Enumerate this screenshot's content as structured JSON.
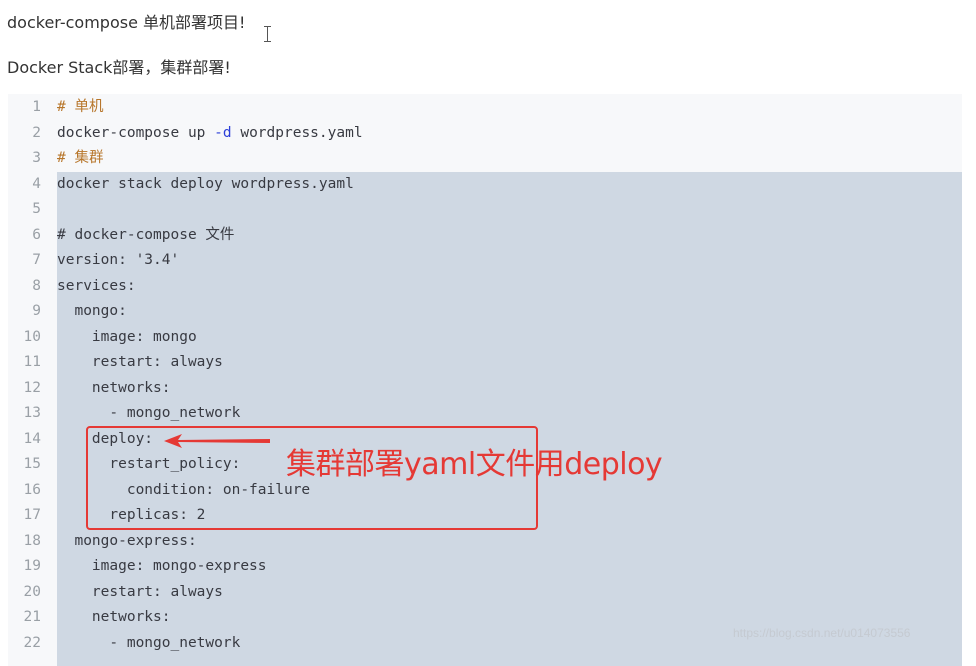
{
  "paragraphs": {
    "p1": "docker-compose  单机部署项目!",
    "p2": "Docker Stack部署，集群部署!"
  },
  "code": {
    "lines": [
      {
        "num": "1",
        "text": "# 单机",
        "type": "comment"
      },
      {
        "num": "2",
        "pre": "docker-compose up ",
        "flag": "-d",
        "post": " wordpress.yaml",
        "type": "flag"
      },
      {
        "num": "3",
        "text": "# 集群",
        "type": "comment"
      },
      {
        "num": "4",
        "text": "docker stack deploy wordpress.yaml",
        "type": "plain"
      },
      {
        "num": "5",
        "text": "",
        "type": "plain"
      },
      {
        "num": "6",
        "text": "# docker-compose 文件",
        "type": "plain"
      },
      {
        "num": "7",
        "text": "version: '3.4'",
        "type": "plain"
      },
      {
        "num": "8",
        "text": "services:",
        "type": "plain"
      },
      {
        "num": "9",
        "text": "  mongo:",
        "type": "plain"
      },
      {
        "num": "10",
        "text": "    image: mongo",
        "type": "plain"
      },
      {
        "num": "11",
        "text": "    restart: always",
        "type": "plain"
      },
      {
        "num": "12",
        "text": "    networks:",
        "type": "plain"
      },
      {
        "num": "13",
        "text": "      - mongo_network",
        "type": "plain"
      },
      {
        "num": "14",
        "text": "    deploy:",
        "type": "plain"
      },
      {
        "num": "15",
        "text": "      restart_policy:",
        "type": "plain"
      },
      {
        "num": "16",
        "text": "        condition: on-failure",
        "type": "plain"
      },
      {
        "num": "17",
        "text": "      replicas: 2",
        "type": "plain"
      },
      {
        "num": "18",
        "text": "  mongo-express:",
        "type": "plain"
      },
      {
        "num": "19",
        "text": "    image: mongo-express",
        "type": "plain"
      },
      {
        "num": "20",
        "text": "    restart: always",
        "type": "plain"
      },
      {
        "num": "21",
        "text": "    networks:",
        "type": "plain"
      },
      {
        "num": "22",
        "text": "      - mongo_network",
        "type": "plain"
      }
    ]
  },
  "annotation": {
    "text": "集群部署yaml文件用deploy",
    "color": "#e53935"
  },
  "watermark": "https://blog.csdn.net/u014073556",
  "icons": {
    "cursor": "text-cursor-icon",
    "arrow": "red-arrow-icon"
  },
  "colors": {
    "comment": "#b7762b",
    "flag": "#2c3fd8",
    "selection": "#cfd8e3",
    "code_bg": "#f7f8fa"
  }
}
